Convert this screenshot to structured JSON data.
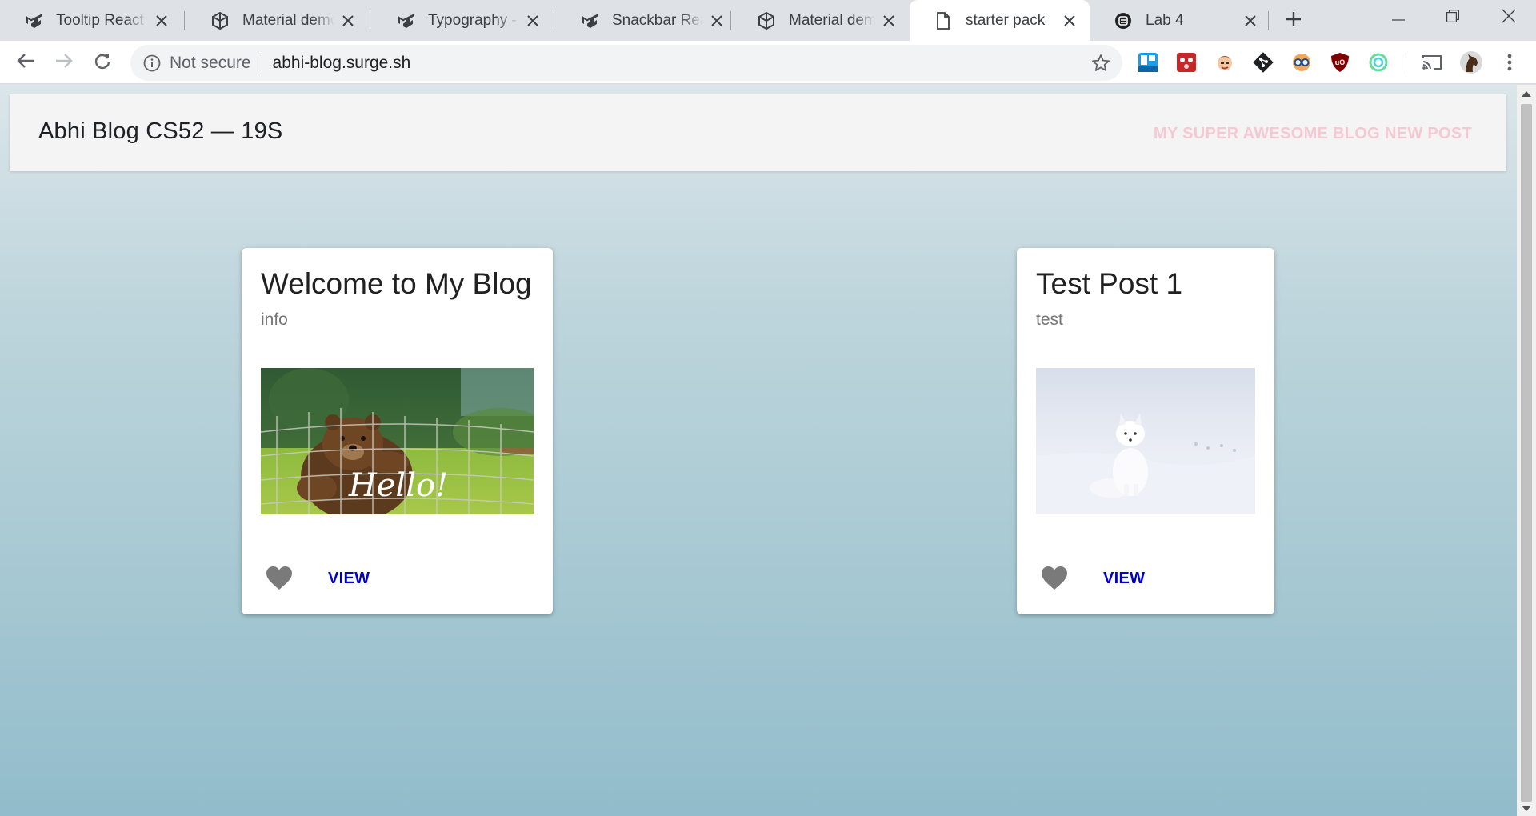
{
  "browser": {
    "tabs": [
      {
        "title": "Tooltip React component - Material-UI",
        "icon": "material-ui-logo-icon",
        "active": false
      },
      {
        "title": "Material demo - CodeSandbox",
        "icon": "codesandbox-icon",
        "active": false
      },
      {
        "title": "Typography - Material-UI",
        "icon": "material-ui-logo-icon",
        "active": false
      },
      {
        "title": "Snackbar React component - Material-UI",
        "icon": "material-ui-logo-icon",
        "active": false
      },
      {
        "title": "Material demo - CodeSandbox",
        "icon": "codesandbox-icon",
        "active": false
      },
      {
        "title": "starter pack",
        "icon": "document-icon",
        "active": true
      },
      {
        "title": "Lab 4",
        "icon": "lab-icon",
        "active": false
      }
    ],
    "omnibox": {
      "security_label": "Not secure",
      "url": "abhi-blog.surge.sh"
    },
    "extensions": [
      "trello-icon",
      "gamepad-extension-icon",
      "face-extension-icon",
      "git-icon",
      "glasses-extension-icon",
      "ublock-icon",
      "circle-extension-icon",
      "cast-icon",
      "profile-avatar-icon",
      "more-menu-icon"
    ]
  },
  "page": {
    "brand": "Abhi Blog CS52 — 19S",
    "nav": {
      "link1": "MY SUPER AWESOME BLOG",
      "link2": "NEW POST",
      "link_color": "#f6c9d2"
    },
    "posts": [
      {
        "title": "Welcome to My Blog",
        "subtitle": "info",
        "image_caption": "Hello!",
        "image_subject": "bear waving behind fence",
        "action": "VIEW"
      },
      {
        "title": "Test Post 1",
        "subtitle": "test",
        "image_subject": "arctic fox in snow",
        "action": "VIEW"
      }
    ]
  }
}
